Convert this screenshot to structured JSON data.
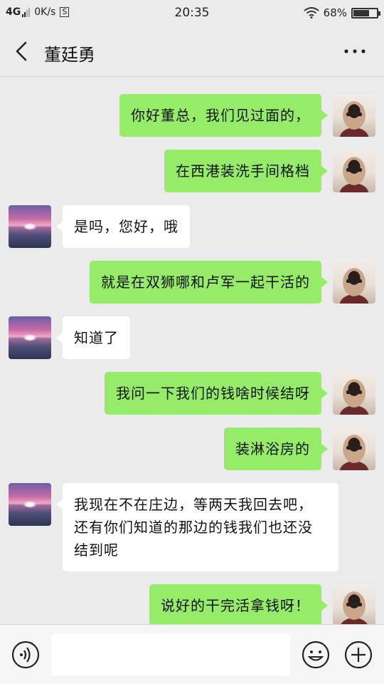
{
  "status_bar": {
    "network": "4G",
    "speed": "0K/s",
    "speed_icon_letter": "S",
    "time": "20:35",
    "battery": "68%",
    "icons": [
      "signal-bars-icon",
      "wifi-icon",
      "battery-icon"
    ]
  },
  "header": {
    "title": "董廷勇",
    "back_icon": "chevron-left-icon",
    "more_icon": "more-dots-icon"
  },
  "messages": [
    {
      "from": "me",
      "text": "你好董总，我们见过面的，"
    },
    {
      "from": "me",
      "text": "在西港装洗手间格档"
    },
    {
      "from": "other",
      "text": "是吗，您好，哦"
    },
    {
      "from": "me",
      "text": "就是在双狮哪和卢军一起干活的"
    },
    {
      "from": "other",
      "text": "知道了"
    },
    {
      "from": "me",
      "text": "我问一下我们的钱啥时候结呀"
    },
    {
      "from": "me",
      "text": "装淋浴房的"
    },
    {
      "from": "other",
      "text": "我现在不在庄边，等两天我回去吧，还有你们知道的那边的钱我们也还没结到呢"
    },
    {
      "from": "me",
      "text": "说好的干完活拿钱呀！"
    }
  ],
  "input_bar": {
    "placeholder": "",
    "voice_icon": "voice-icon",
    "emoji_icon": "emoji-icon",
    "plus_icon": "plus-icon"
  },
  "colors": {
    "background": "#ebebeb",
    "my_bubble": "#95ec69",
    "other_bubble": "#ffffff"
  }
}
